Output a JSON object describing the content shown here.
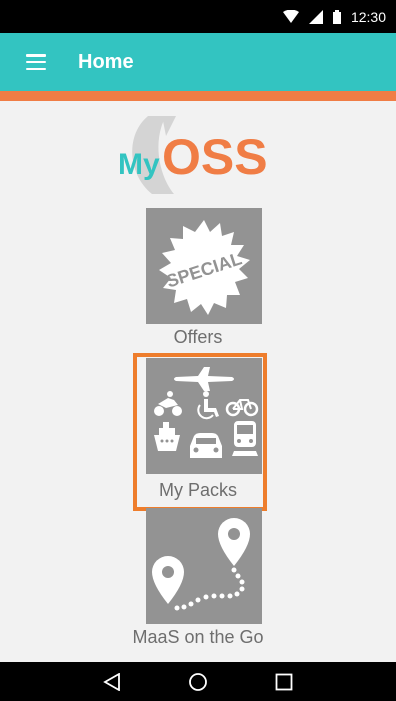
{
  "status_bar": {
    "time": "12:30",
    "icons": [
      "wifi-icon",
      "signal-icon",
      "battery-icon"
    ]
  },
  "app_bar": {
    "title": "Home",
    "menu_icon": "menu-icon",
    "color": "#33c4c1",
    "stripe_color": "#f07d45"
  },
  "logo": {
    "prefix": "My",
    "name": "OSS",
    "prefix_color": "#33c4c1",
    "name_color": "#f07d45"
  },
  "tiles": [
    {
      "label": "Offers",
      "icon": "special-badge-icon",
      "badge_text": "SPECIAL"
    },
    {
      "label": "My Packs",
      "icon": "transport-modes-icon",
      "highlighted": true
    },
    {
      "label": "MaaS on the Go",
      "icon": "route-pins-icon"
    }
  ],
  "highlight_color": "#ee7d2c",
  "nav_bar": {
    "buttons": [
      "back-icon",
      "home-icon",
      "recents-icon"
    ]
  }
}
